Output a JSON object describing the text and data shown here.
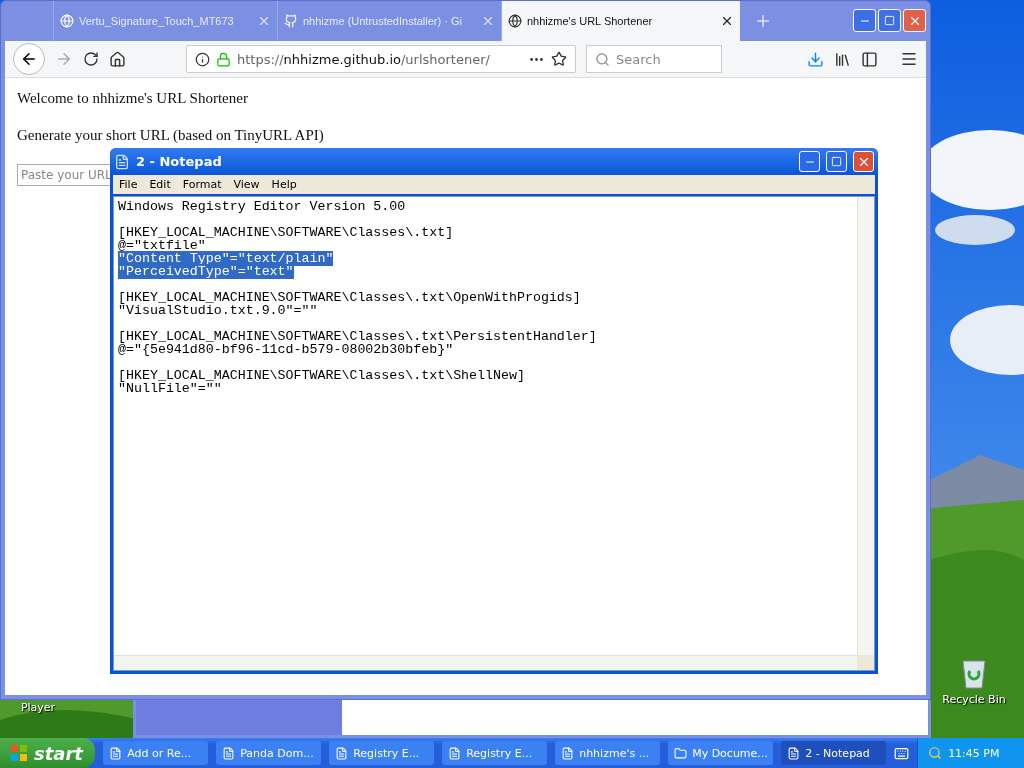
{
  "desktop": {
    "icons": [
      {
        "kind": "player",
        "label": "Player"
      },
      {
        "kind": "bin",
        "label": "Recycle Bin"
      }
    ]
  },
  "browser": {
    "tabs": [
      {
        "title": "Vertu_Signature_Touch_MT673",
        "selected": false
      },
      {
        "title": "nhhizme (UntrustedInstaller) · Gi",
        "selected": false
      },
      {
        "title": "nhhizme's URL Shortener",
        "selected": true
      }
    ],
    "url_prefix": "https://",
    "url_host": "nhhizme.github.io",
    "url_path": "/urlshortener/",
    "search": {
      "placeholder": "Search"
    },
    "page": {
      "heading": "Welcome to nhhizme's URL Shortener",
      "subheading": "Generate your short URL (based on TinyURL API)",
      "url_field": {
        "placeholder": "Paste your URL"
      }
    }
  },
  "background_window": {
    "progress": {
      "level": 0.26
    }
  },
  "notepad": {
    "title": "2 - Notepad",
    "menu": [
      "File",
      "Edit",
      "Format",
      "View",
      "Help"
    ],
    "lines": [
      {
        "text": "Windows Registry Editor Version 5.00",
        "selected": false
      },
      {
        "kind": "blank"
      },
      {
        "text": "[HKEY_LOCAL_MACHINE\\SOFTWARE\\Classes\\.txt]",
        "selected": false
      },
      {
        "text": "@=\"txtfile\"",
        "selected": false
      },
      {
        "text": "\"Content Type\"=\"text/plain\"",
        "selected": true
      },
      {
        "text": "\"PerceivedType\"=\"text\"",
        "selected": true
      },
      {
        "kind": "blank"
      },
      {
        "text": "[HKEY_LOCAL_MACHINE\\SOFTWARE\\Classes\\.txt\\OpenWithProgids]",
        "selected": false
      },
      {
        "text": "\"VisualStudio.txt.9.0\"=\"\"",
        "selected": false
      },
      {
        "kind": "blank"
      },
      {
        "text": "[HKEY_LOCAL_MACHINE\\SOFTWARE\\Classes\\.txt\\PersistentHandler]",
        "selected": false
      },
      {
        "text": "@=\"{5e941d80-bf96-11cd-b579-08002b30bfeb}\"",
        "selected": false
      },
      {
        "kind": "blank"
      },
      {
        "text": "[HKEY_LOCAL_MACHINE\\SOFTWARE\\Classes\\.txt\\ShellNew]",
        "selected": false
      },
      {
        "text": "\"NullFile\"=\"\"",
        "selected": false
      }
    ]
  },
  "taskbar": {
    "start": "start",
    "items": [
      {
        "label": "Add or Re...",
        "selected": false
      },
      {
        "label": "Panda Dom...",
        "selected": false
      },
      {
        "label": "Registry E...",
        "selected": false
      },
      {
        "label": "Registry E...",
        "selected": false
      },
      {
        "label": "nhhizme's ...",
        "selected": false
      },
      {
        "label": "My Docume...",
        "selected": false
      },
      {
        "label": "2 - Notepad",
        "selected": true
      }
    ],
    "clock": "11:45 PM"
  }
}
